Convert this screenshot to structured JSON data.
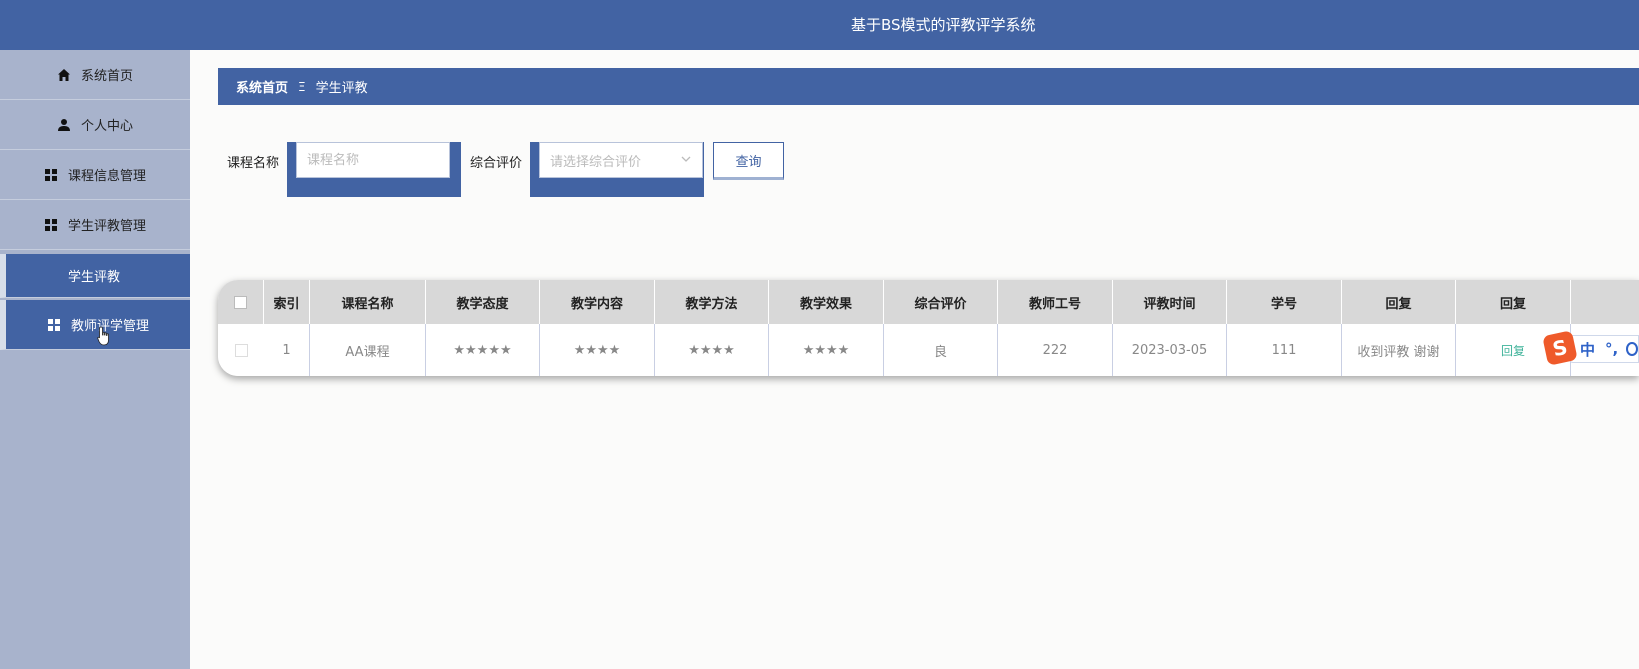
{
  "header": {
    "title": "基于BS模式的评教评学系统"
  },
  "sidebar": {
    "items": [
      {
        "label": "系统首页",
        "icon": "home-icon"
      },
      {
        "label": "个人中心",
        "icon": "user-icon"
      },
      {
        "label": "课程信息管理",
        "icon": "grid-icon"
      },
      {
        "label": "学生评教管理",
        "icon": "grid-icon"
      },
      {
        "label": "学生评教",
        "icon": ""
      },
      {
        "label": "教师评学管理",
        "icon": "grid-icon"
      }
    ]
  },
  "breadcrumb": {
    "home": "系统首页",
    "separator": "Ξ",
    "current": "学生评教"
  },
  "search": {
    "course_label": "课程名称",
    "course_placeholder": "课程名称",
    "rating_label": "综合评价",
    "rating_placeholder": "请选择综合评价",
    "query_button": "查询"
  },
  "table": {
    "headers": [
      "索引",
      "课程名称",
      "教学态度",
      "教学内容",
      "教学方法",
      "教学效果",
      "综合评价",
      "教师工号",
      "评教时间",
      "学号",
      "回复",
      "回复"
    ],
    "rows": [
      [
        "1",
        "AA课程",
        "★★★★★",
        "★★★★",
        "★★★★",
        "★★★★",
        "良",
        "222",
        "2023-03-05",
        "111",
        "收到评教 谢谢",
        "回复"
      ]
    ]
  },
  "ime": {
    "logo": "S",
    "lang": "中",
    "punct": "°,"
  },
  "colors": {
    "primary": "#4263a3",
    "sidebar": "#a8b3cc",
    "reply_link": "#3fb39a"
  }
}
